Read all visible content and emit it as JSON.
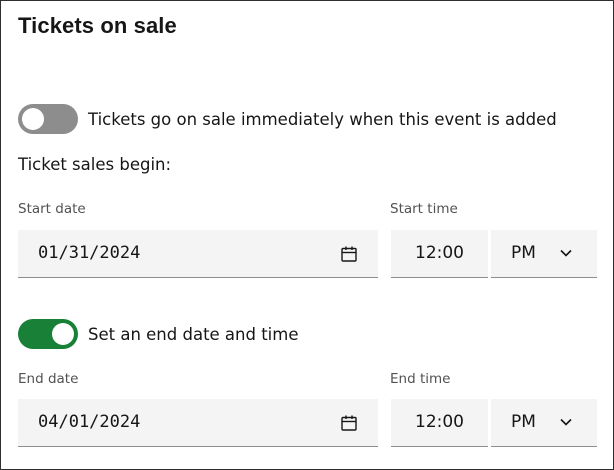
{
  "title": "Tickets on sale",
  "toggles": {
    "immediate": {
      "label": "Tickets go on sale immediately when this event is added",
      "state": "off"
    },
    "end": {
      "label": "Set an end date and time",
      "state": "on"
    }
  },
  "subhead": "Ticket sales begin:",
  "start": {
    "date_label": "Start date",
    "date_value": "01/31/2024",
    "time_label": "Start time",
    "time_value": "12:00",
    "period": "PM"
  },
  "end": {
    "date_label": "End date",
    "date_value": "04/01/2024",
    "time_label": "End time",
    "time_value": "12:00",
    "period": "PM"
  },
  "icons": {
    "calendar": "calendar-icon",
    "chevron": "chevron-down-icon"
  },
  "colors": {
    "toggle_on": "#198038",
    "toggle_off": "#8d8d8d",
    "field_bg": "#f4f4f4"
  }
}
